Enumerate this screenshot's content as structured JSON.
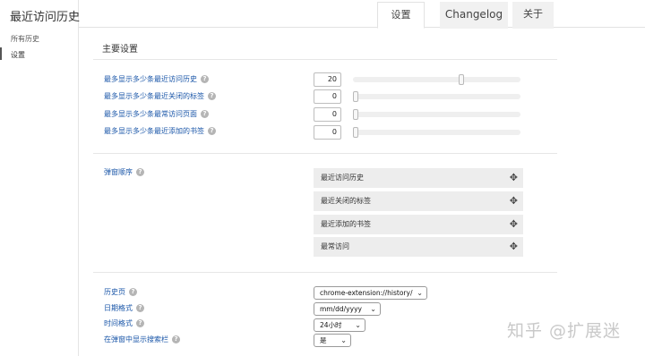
{
  "app_title": "最近访问历史",
  "sidebar": {
    "items": [
      {
        "label": "所有历史"
      },
      {
        "label": "设置"
      }
    ]
  },
  "tabs": [
    {
      "label": "设置"
    },
    {
      "label": "Changelog"
    },
    {
      "label": "关于"
    }
  ],
  "main": {
    "section_title": "主要设置",
    "counts": [
      {
        "label": "最多显示多少条最近访问历史",
        "value": "20",
        "slider_level": 0.65
      },
      {
        "label": "最多显示多少条最近关闭的标签",
        "value": "0",
        "slider_level": 0.0
      },
      {
        "label": "最多显示多少条最常访问页面",
        "value": "0",
        "slider_level": 0.0
      },
      {
        "label": "最多显示多少条最近添加的书签",
        "value": "0",
        "slider_level": 0.0
      }
    ],
    "popup_order": {
      "label": "弹窗顺序",
      "items": [
        "最近访问历史",
        "最近关闭的标签",
        "最近添加的书签",
        "最常访问"
      ]
    },
    "other": {
      "history_page": {
        "label": "历史页",
        "value": "chrome-extension://history/"
      },
      "date_format": {
        "label": "日期格式",
        "value": "mm/dd/yyyy"
      },
      "time_format": {
        "label": "时间格式",
        "value": "24小时"
      },
      "show_search": {
        "label": "在弹窗中显示搜索栏",
        "value": "是"
      }
    }
  },
  "watermark": "知乎 @扩展迷",
  "icons": {
    "help": "?",
    "move": "✥",
    "chevron": "⌄"
  }
}
